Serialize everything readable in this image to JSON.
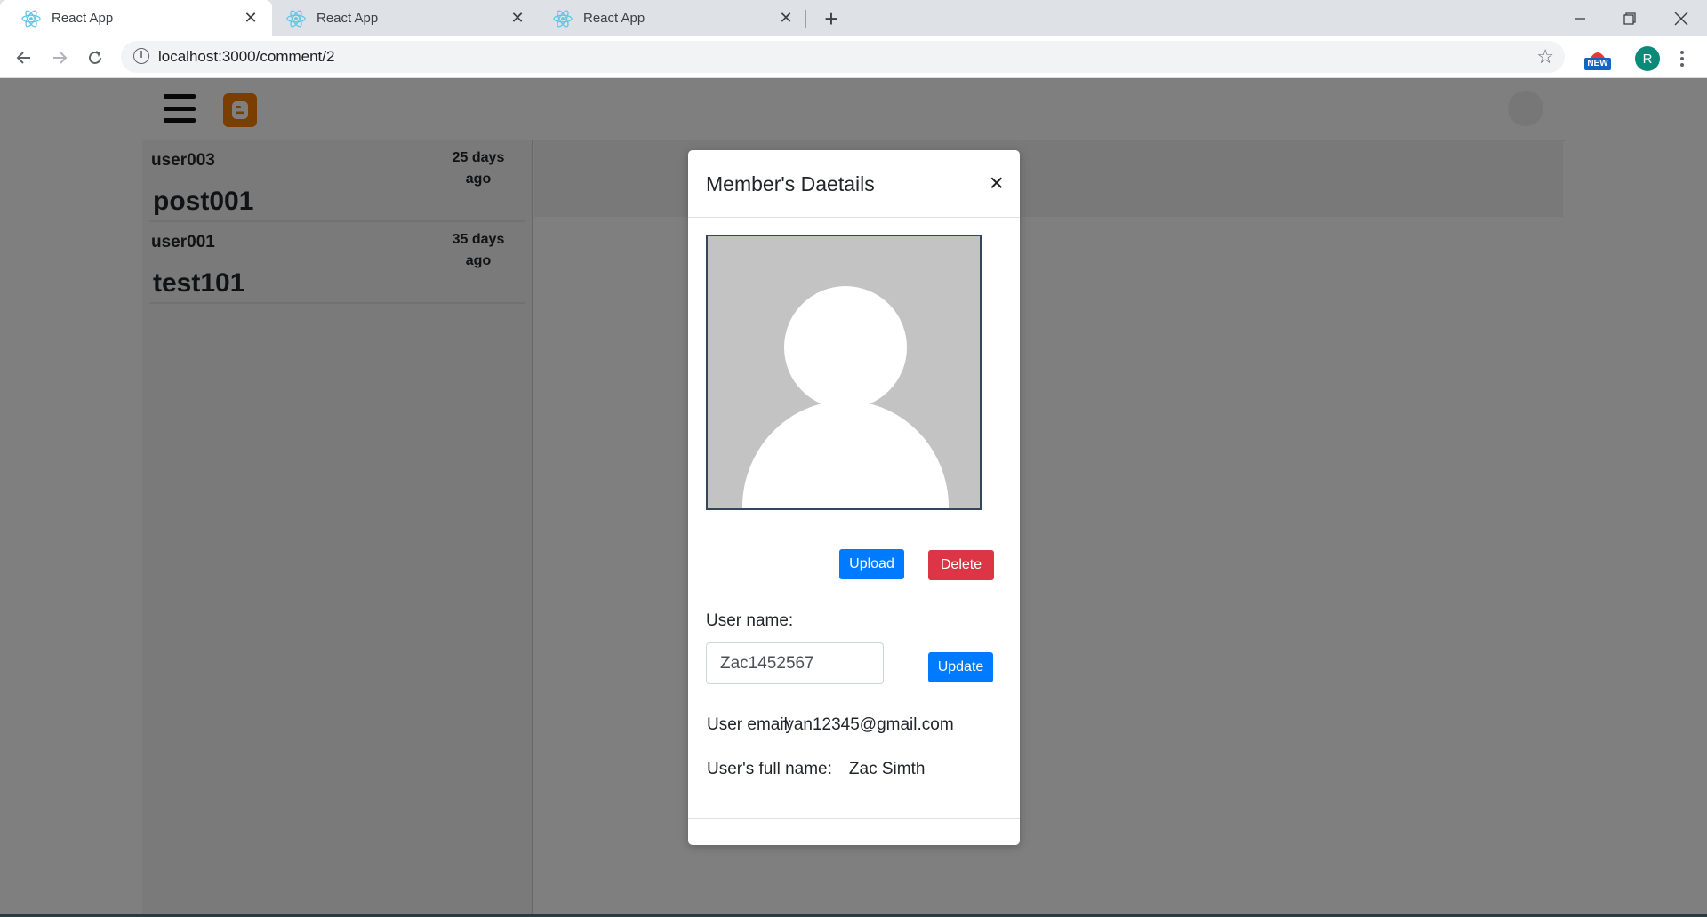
{
  "browser": {
    "tabs": [
      {
        "title": "React App",
        "active": true
      },
      {
        "title": "React App",
        "active": false
      },
      {
        "title": "React App",
        "active": false
      }
    ],
    "url": "localhost:3000/comment/2",
    "profile_initial": "R",
    "extension_badge": "NEW"
  },
  "app": {
    "posts": [
      {
        "user": "user003",
        "ago": "25 days ago",
        "title": "post001"
      },
      {
        "user": "user001",
        "ago": "35 days ago",
        "title": "test101"
      }
    ]
  },
  "modal": {
    "title": "Member's Daetails",
    "upload_label": "Upload",
    "delete_label": "Delete",
    "username_label": "User name:",
    "username_value": "Zac1452567",
    "update_label": "Update",
    "email_label": "User email:",
    "email_value": "ryan12345@gmail.com",
    "fullname_label": "User's full name:",
    "fullname_value": "Zac Simth"
  },
  "colors": {
    "primary": "#007bff",
    "danger": "#dc3545",
    "blogger": "#f57d00",
    "profile": "#0b8a7a"
  }
}
